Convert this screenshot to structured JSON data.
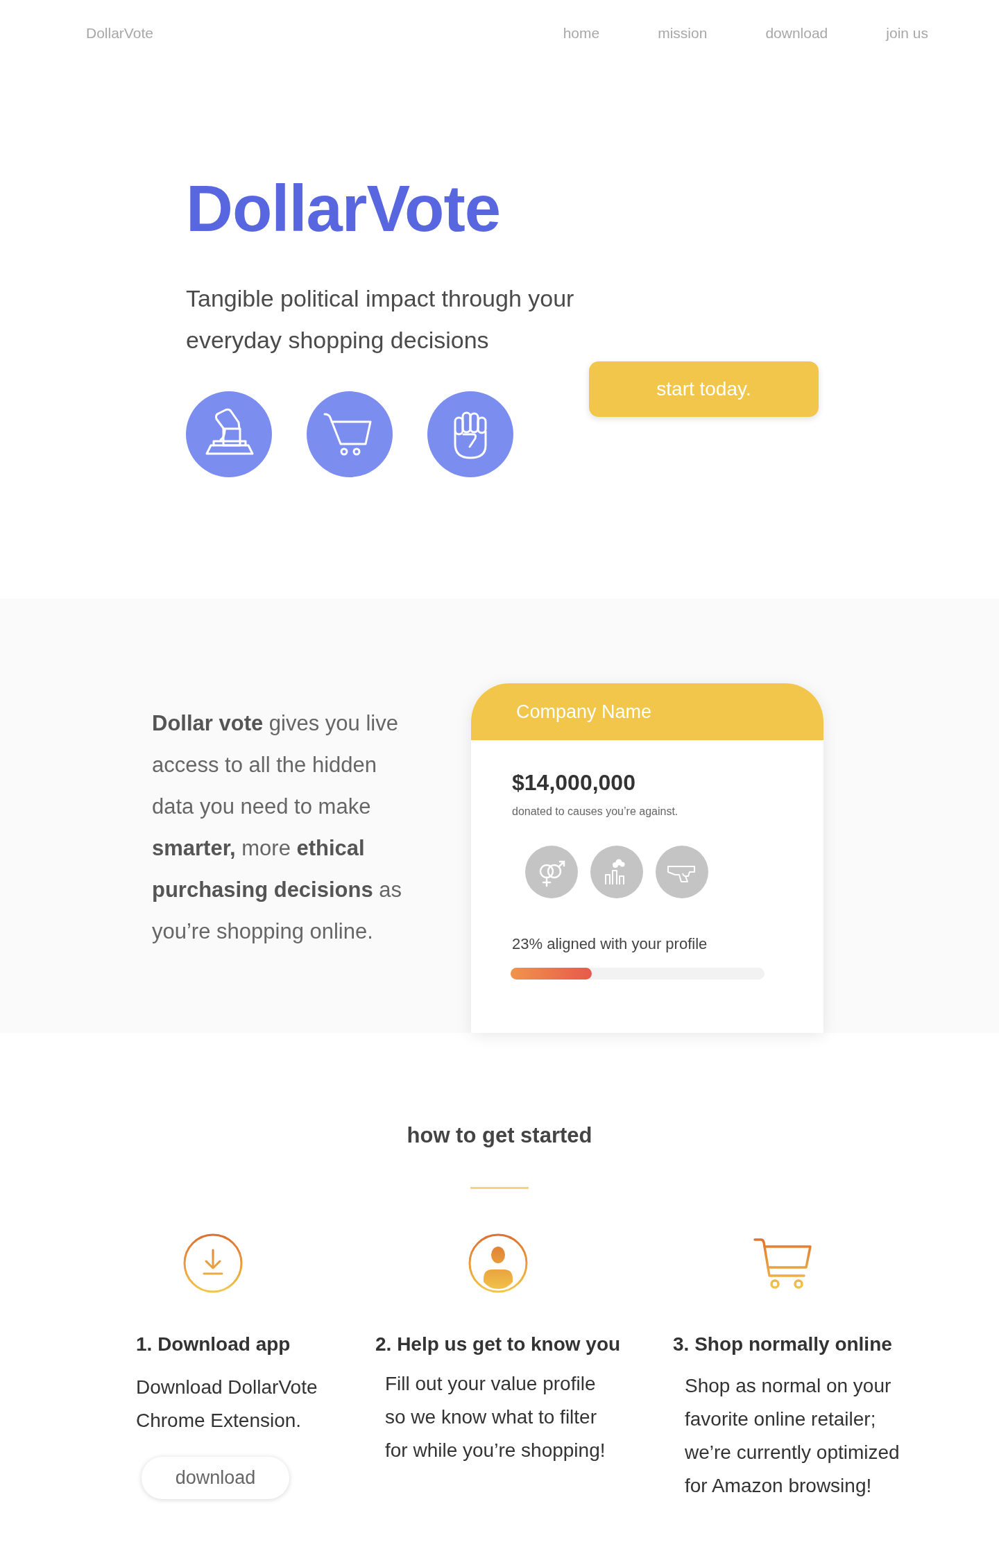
{
  "nav": {
    "brand": "DollarVote",
    "links": [
      "home",
      "mission",
      "download",
      "join us"
    ]
  },
  "hero": {
    "title": "DollarVote",
    "tagline": "Tangible political impact through your everyday shopping decisions",
    "cta": "start today."
  },
  "intro": {
    "text": "**Dollar vote** gives you live access to all the hidden data you need to make **smarter,** more **ethical purchasing decisions** as you’re shopping online."
  },
  "card": {
    "company_name": "Company Name",
    "amount": "$14,000,000",
    "amount_caption": "donated to causes you’re against.",
    "alignment": {
      "label": "23% aligned with your profile",
      "level": 0.32
    }
  },
  "how": {
    "heading": "how to get started",
    "steps": [
      {
        "title": "1. Download app",
        "body": "Download DollarVote Chrome Extension.",
        "button": "download"
      },
      {
        "title": "2. Help us get to know you",
        "body": "Fill out your value profile so we know what to filter for while you’re shopping!"
      },
      {
        "title": "3. Shop normally online",
        "body": "Shop as normal on your favorite online retailer; we’re currently optimized for Amazon browsing!"
      }
    ]
  }
}
